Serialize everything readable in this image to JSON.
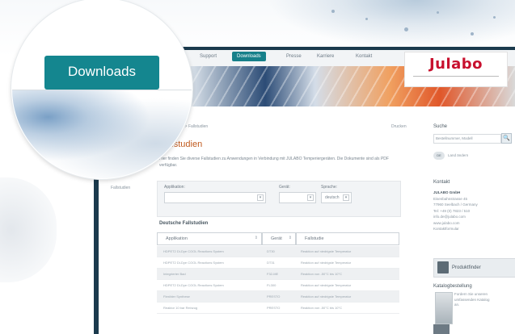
{
  "nav": {
    "items": [
      "Support",
      "Downloads",
      "Presse",
      "Karriere",
      "Kontakt"
    ],
    "active": "Downloads"
  },
  "logo": {
    "text": "Julabo"
  },
  "lens": {
    "button_label": "Downloads"
  },
  "page": {
    "breadcrumb": "... Downloads > Fallstudien",
    "print": "Drucken",
    "title": "Fallstudien",
    "intro": "Hier finden Sie diverse Fallstudien zu Anwendungen in Verbindung mit JULABO Temperiergeräten. Die Dokumente sind als PDF verfügbar.",
    "sidebar_link": "Fallstudien"
  },
  "filters": {
    "applikation_label": "Applikation:",
    "geraet_label": "Gerät:",
    "sprache_label": "Sprache:",
    "sprache_value": "deutsch"
  },
  "table": {
    "heading": "Deutsche Fallstudien",
    "columns": [
      "Applikation",
      "Gerät",
      "Fallstudie"
    ],
    "rows": [
      [
        "HDPET2 Di-Dye COOL Reactions System",
        "DT30",
        "Reaktion auf niedrigste Temperatur"
      ],
      [
        "HDPET2 Di-Dye COOL Reactions System",
        "DT31",
        "Reaktion auf niedrigste Temperatur"
      ],
      [
        "Integrierter Bad",
        "F32-ME",
        "Reaktion von -50°C bis 10°C"
      ],
      [
        "HDPET2 Di-Dye COOL Reactions System",
        "FL300",
        "Reaktion auf niedrigste Temperatur"
      ],
      [
        "Flexibler Synthese",
        "PRESTO",
        "Reaktion auf niedrigste Temperatur"
      ],
      [
        "Reaktor 10 bar Reinzug",
        "PRESTO",
        "Reaktion von -50°C bis 10°C"
      ]
    ]
  },
  "sidebar": {
    "search_heading": "Suche",
    "search_placeholder": "Bestellnummer, Modell",
    "search_button": "🔍",
    "country_label": "Land ändern",
    "kontakt_heading": "Kontakt",
    "kontakt_company": "JULABO GmbH",
    "kontakt_lines": [
      "Eisenbahnstrasse 45",
      "77960 Seelbach / Germany",
      "Tel: +49 (0) 7823 / 510",
      "info.de@julabo.com",
      "www.julabo.com",
      "Kontaktformular"
    ],
    "produktfinder": "Produktfinder",
    "katalog_heading": "Katalogbestellung",
    "katalog_text": "Fordern Sie unseren umfassenden Katalog an."
  }
}
